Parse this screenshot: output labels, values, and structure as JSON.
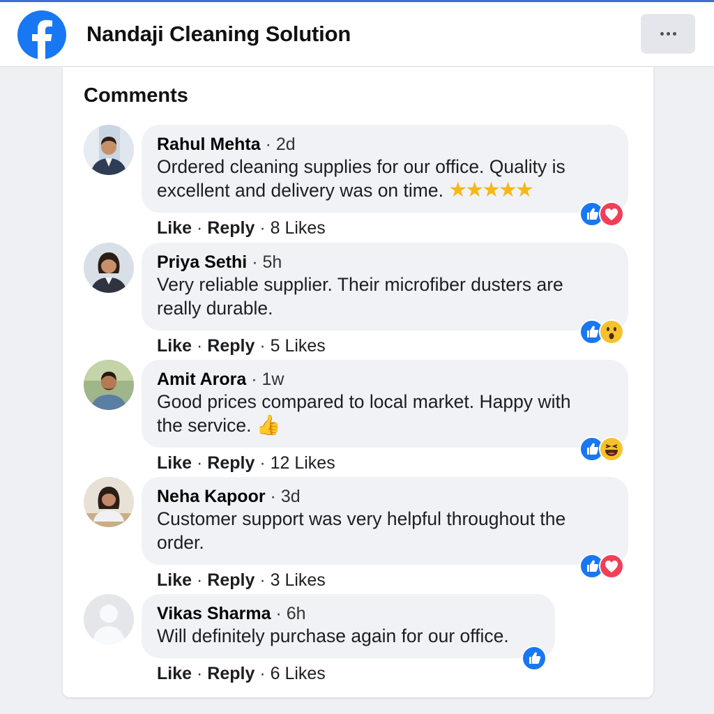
{
  "app": {
    "page_name": "Nandaji Cleaning Solution",
    "brand_color": "#1877f2"
  },
  "section": {
    "title": "Comments"
  },
  "actions": {
    "like_label": "Like",
    "reply_label": "Reply",
    "separator": "·"
  },
  "comments": [
    {
      "author": "Rahul Mehta",
      "time": "2d",
      "line1": "Ordered cleaning supplies for our office. Quality is",
      "line2": "excellent and delivery was on time.",
      "emoji": "star-rating-5",
      "stars": 5,
      "likes": "8 Likes",
      "reactions": [
        "like-icon",
        "love-icon"
      ]
    },
    {
      "author": "Priya Sethi",
      "time": "5h",
      "line1": "Very reliable supplier. Their microfiber dusters are",
      "line2": "really durable.",
      "likes": "5 Likes",
      "reactions": [
        "like-icon",
        "wow-icon"
      ]
    },
    {
      "author": "Amit Arora",
      "time": "1w",
      "line1": "Good prices compared to local market. Happy with",
      "line2": "the service.",
      "emoji": "thumbs-up",
      "likes": "12 Likes",
      "reactions": [
        "like-icon",
        "haha-icon"
      ]
    },
    {
      "author": "Neha Kapoor",
      "time": "3d",
      "line1": "Customer support was very helpful throughout the",
      "line2": "order.",
      "likes": "3 Likes",
      "reactions": [
        "like-icon",
        "love-icon"
      ]
    },
    {
      "author": "Vikas Sharma",
      "time": "6h",
      "line1": "Will definitely purchase again for our office.",
      "likes": "6 Likes",
      "reactions": [
        "like-icon"
      ]
    }
  ]
}
